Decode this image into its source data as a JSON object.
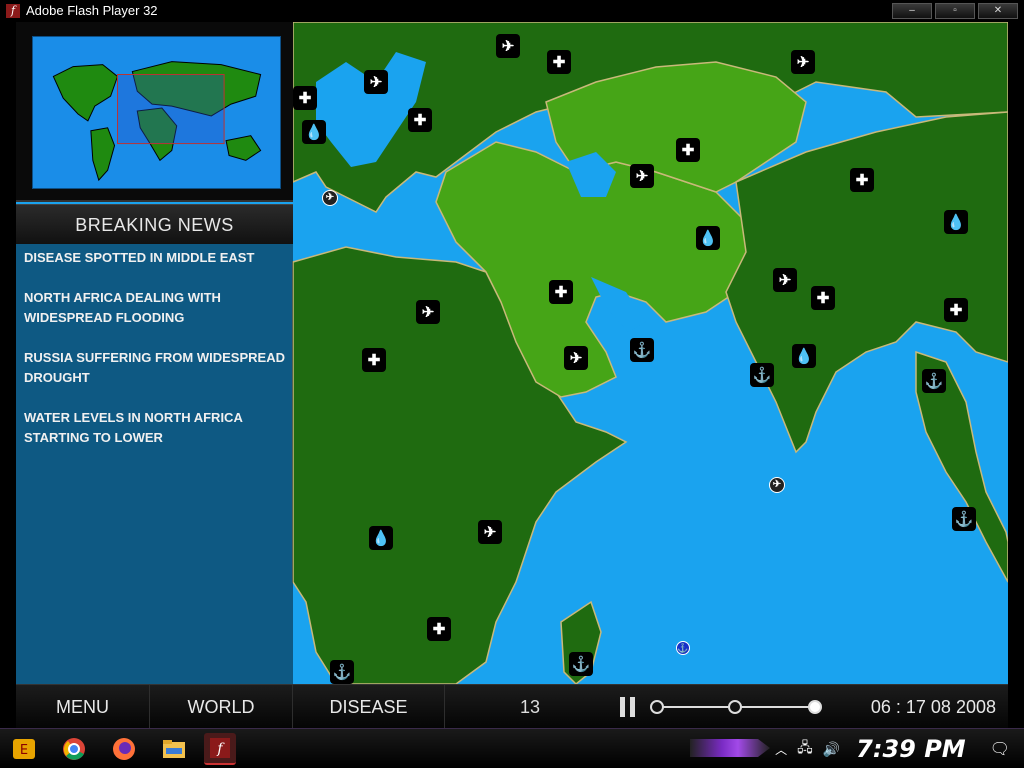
{
  "window": {
    "title": "Adobe Flash Player 32",
    "controls": [
      "–",
      "▫",
      "✕"
    ]
  },
  "minimap": {
    "label": ""
  },
  "news": {
    "header": "BREAKING NEWS",
    "items": [
      "DISEASE SPOTTED IN MIDDLE EAST",
      "NORTH AFRICA DEALING WITH WIDESPREAD FLOODING",
      "RUSSIA SUFFERING FROM WIDESPREAD DROUGHT",
      "WATER LEVELS IN NORTH AFRICA STARTING TO LOWER"
    ]
  },
  "toolbar": {
    "menu_label": "MENU",
    "world_label": "WORLD",
    "disease_label": "DISEASE",
    "speed_value": "13",
    "date_text": "06 : 17 08 2008",
    "speed_level": 1.0
  },
  "markers": {
    "glyphs": {
      "plane": "✈",
      "hospital": "✚",
      "drop": "💧",
      "anchor": "⚓"
    }
  },
  "taskbar": {
    "clock": "7:39 PM",
    "apps": [
      "start-icon",
      "chrome-icon",
      "firefox-icon",
      "explorer-icon",
      "flash-icon"
    ]
  },
  "colors": {
    "ocean": "#1aa3ef",
    "land_dark": "#1f6b10",
    "land_light": "#46a517",
    "border": "#c9b97a"
  }
}
